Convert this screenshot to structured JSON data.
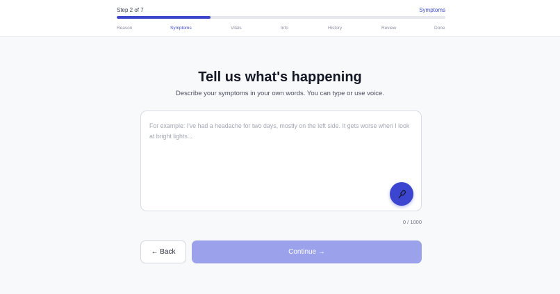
{
  "header": {
    "step_count": "Step 2 of 7",
    "current_step": "Symptoms",
    "progress_fraction": 0.2857,
    "accent_color": "#3d47cc",
    "steps": [
      {
        "label": "Reason",
        "active": false
      },
      {
        "label": "Symptoms",
        "active": true
      },
      {
        "label": "Vitals",
        "active": false
      },
      {
        "label": "Info",
        "active": false
      },
      {
        "label": "History",
        "active": false
      },
      {
        "label": "Review",
        "active": false
      },
      {
        "label": "Done",
        "active": false
      }
    ]
  },
  "main": {
    "title": "Tell us what's happening",
    "subtitle": "Describe your symptoms in your own words. You can type or use voice.",
    "symptoms_input": {
      "value": "",
      "placeholder": "For example: I've had a headache for two days, mostly on the left side. It gets worse when I look at bright lights..."
    },
    "mic_icon": "microphone-icon",
    "char_count": "0 / 1000"
  },
  "footer": {
    "back_label": "← Back",
    "continue_label": "Continue →",
    "continue_color": "#9ba2eb"
  }
}
